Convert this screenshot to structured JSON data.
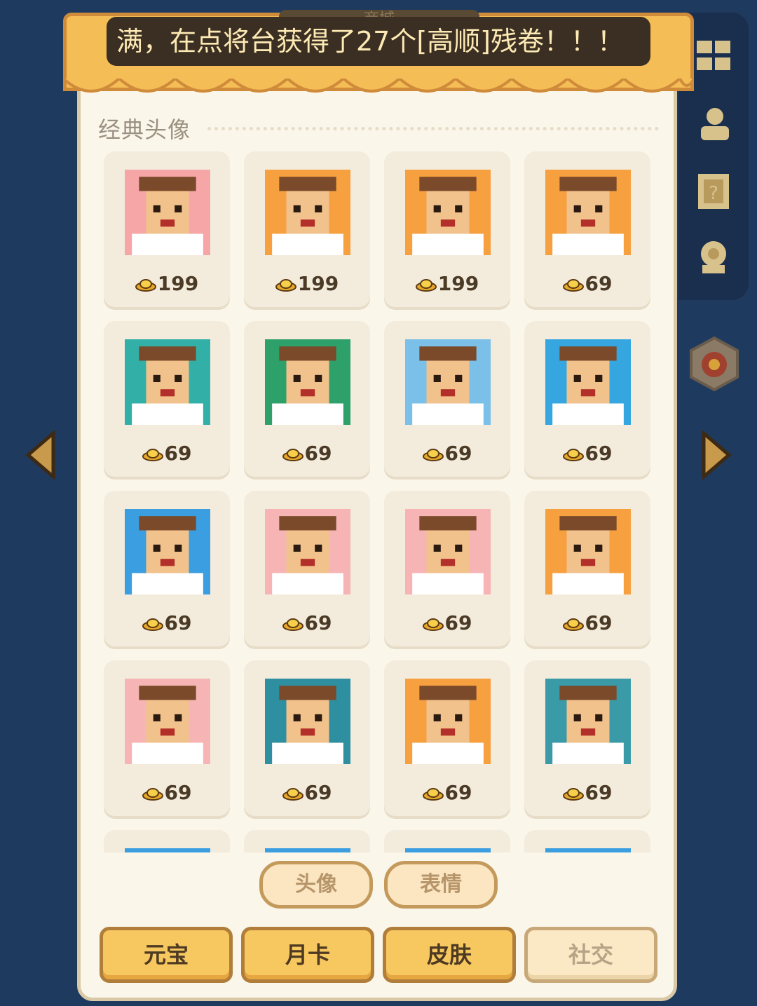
{
  "shop": {
    "title": "商城",
    "marquee": "满，在点将台获得了27个[高顺]残卷！！！"
  },
  "section": {
    "title": "经典头像"
  },
  "colors": {
    "background": "#1e3a5f",
    "panel": "#fbf6ea",
    "awning": "#f5bd55",
    "button": "#f7c860",
    "text_dark": "#4a3a26"
  },
  "avatars": [
    {
      "price": "199",
      "theme": "white-rooster-icon",
      "bg": "#f6a6a6"
    },
    {
      "price": "199",
      "theme": "red-face-general-icon",
      "bg": "#f7a040"
    },
    {
      "price": "199",
      "theme": "laughing-monk-icon",
      "bg": "#f7a040"
    },
    {
      "price": "69",
      "theme": "female-warrior-icon",
      "bg": "#f7a040"
    },
    {
      "price": "69",
      "theme": "bearded-general-icon",
      "bg": "#32b0a8"
    },
    {
      "price": "69",
      "theme": "angry-warrior-icon",
      "bg": "#2ea06a"
    },
    {
      "price": "69",
      "theme": "hamster-icon",
      "bg": "#7ac0e8"
    },
    {
      "price": "69",
      "theme": "green-helmet-girl-icon",
      "bg": "#35a6e0"
    },
    {
      "price": "69",
      "theme": "golden-hair-girl-icon",
      "bg": "#3a9ee0"
    },
    {
      "price": "69",
      "theme": "white-beard-elder-icon",
      "bg": "#f6b4b4"
    },
    {
      "price": "69",
      "theme": "hardhat-worker-icon",
      "bg": "#f6b4b4"
    },
    {
      "price": "69",
      "theme": "tiger-hat-creature-icon",
      "bg": "#f7a040"
    },
    {
      "price": "69",
      "theme": "lucky-cat-icon",
      "bg": "#f6b4b4"
    },
    {
      "price": "69",
      "theme": "penguin-icon",
      "bg": "#2e8fa0"
    },
    {
      "price": "69",
      "theme": "tiger-icon",
      "bg": "#f7a040"
    },
    {
      "price": "69",
      "theme": "bull-icon",
      "bg": "#3a9aa8"
    }
  ],
  "sub_tabs": [
    "头像",
    "表情"
  ],
  "bottom_tabs": [
    "元宝",
    "月卡",
    "皮肤",
    "社交"
  ]
}
